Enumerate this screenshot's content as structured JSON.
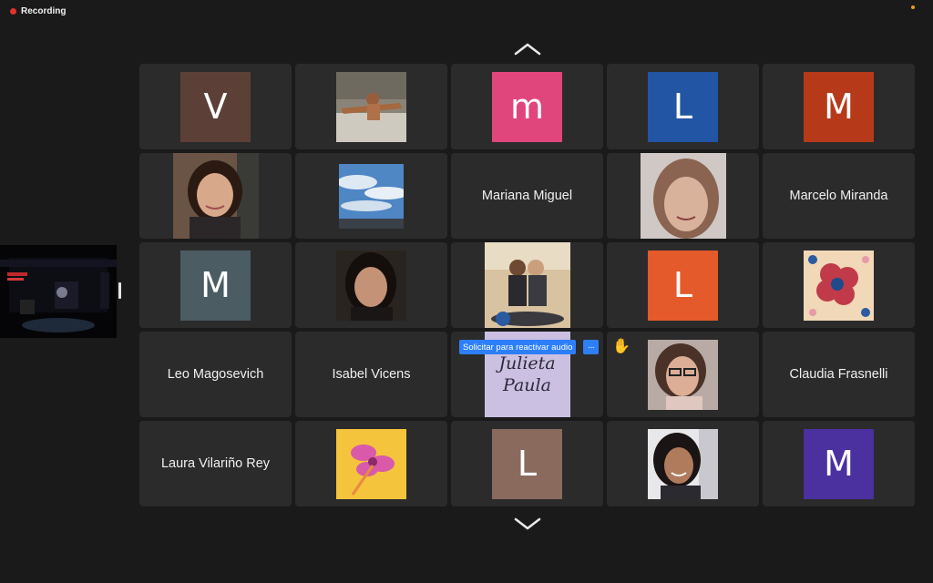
{
  "recording": {
    "label": "Recording",
    "color": "#e5322d"
  },
  "navigation": {
    "up_icon": "chevron-up-icon",
    "down_icon": "chevron-down-icon"
  },
  "participants": [
    {
      "type": "initial",
      "initial": "V",
      "color": "#5c4037"
    },
    {
      "type": "photo",
      "icon": "person-outdoors-photo"
    },
    {
      "type": "initial",
      "initial": "m",
      "color": "#e0457b"
    },
    {
      "type": "initial",
      "initial": "L",
      "color": "#2255a4"
    },
    {
      "type": "initial",
      "initial": "M",
      "color": "#b63a19"
    },
    {
      "type": "photo",
      "icon": "woman-portrait-photo"
    },
    {
      "type": "photo",
      "icon": "sky-clouds-photo"
    },
    {
      "type": "name",
      "name": "Mariana Miguel"
    },
    {
      "type": "photo",
      "icon": "woman-selfie-photo"
    },
    {
      "type": "name",
      "name": "Marcelo Miranda"
    },
    {
      "type": "initial",
      "initial": "M",
      "color": "#4b5c63"
    },
    {
      "type": "photo",
      "icon": "woman-dark-hair-photo"
    },
    {
      "type": "photo",
      "icon": "couple-motorcycle-photo"
    },
    {
      "type": "initial",
      "initial": "L",
      "color": "#e45a2a"
    },
    {
      "type": "photo",
      "icon": "floral-tile-photo"
    },
    {
      "type": "name",
      "name": "Leo Magosevich"
    },
    {
      "type": "name",
      "name": "Isabel Vicens"
    },
    {
      "type": "photo",
      "icon": "julieta-paula-card",
      "card_text_1": "Julieta",
      "card_text_2": "Paula"
    },
    {
      "type": "photo",
      "icon": "woman-glasses-photo"
    },
    {
      "type": "name",
      "name": "Claudia Frasnelli"
    },
    {
      "type": "name",
      "name": "Laura Vilariño Rey"
    },
    {
      "type": "photo",
      "icon": "pink-flower-photo"
    },
    {
      "type": "initial",
      "initial": "L",
      "color": "#8b6a5e"
    },
    {
      "type": "photo",
      "icon": "woman-smiling-photo"
    },
    {
      "type": "initial",
      "initial": "M",
      "color": "#4b30a0"
    }
  ],
  "unmute_request": {
    "label": "Solicitar para reactivar audio",
    "more_label": "···",
    "color": "#2d7ff9"
  },
  "raised_hand": {
    "icon": "raised-hand-icon",
    "glyph": "✋"
  },
  "share_panel": {
    "icon": "screen-share-thumbnail"
  }
}
